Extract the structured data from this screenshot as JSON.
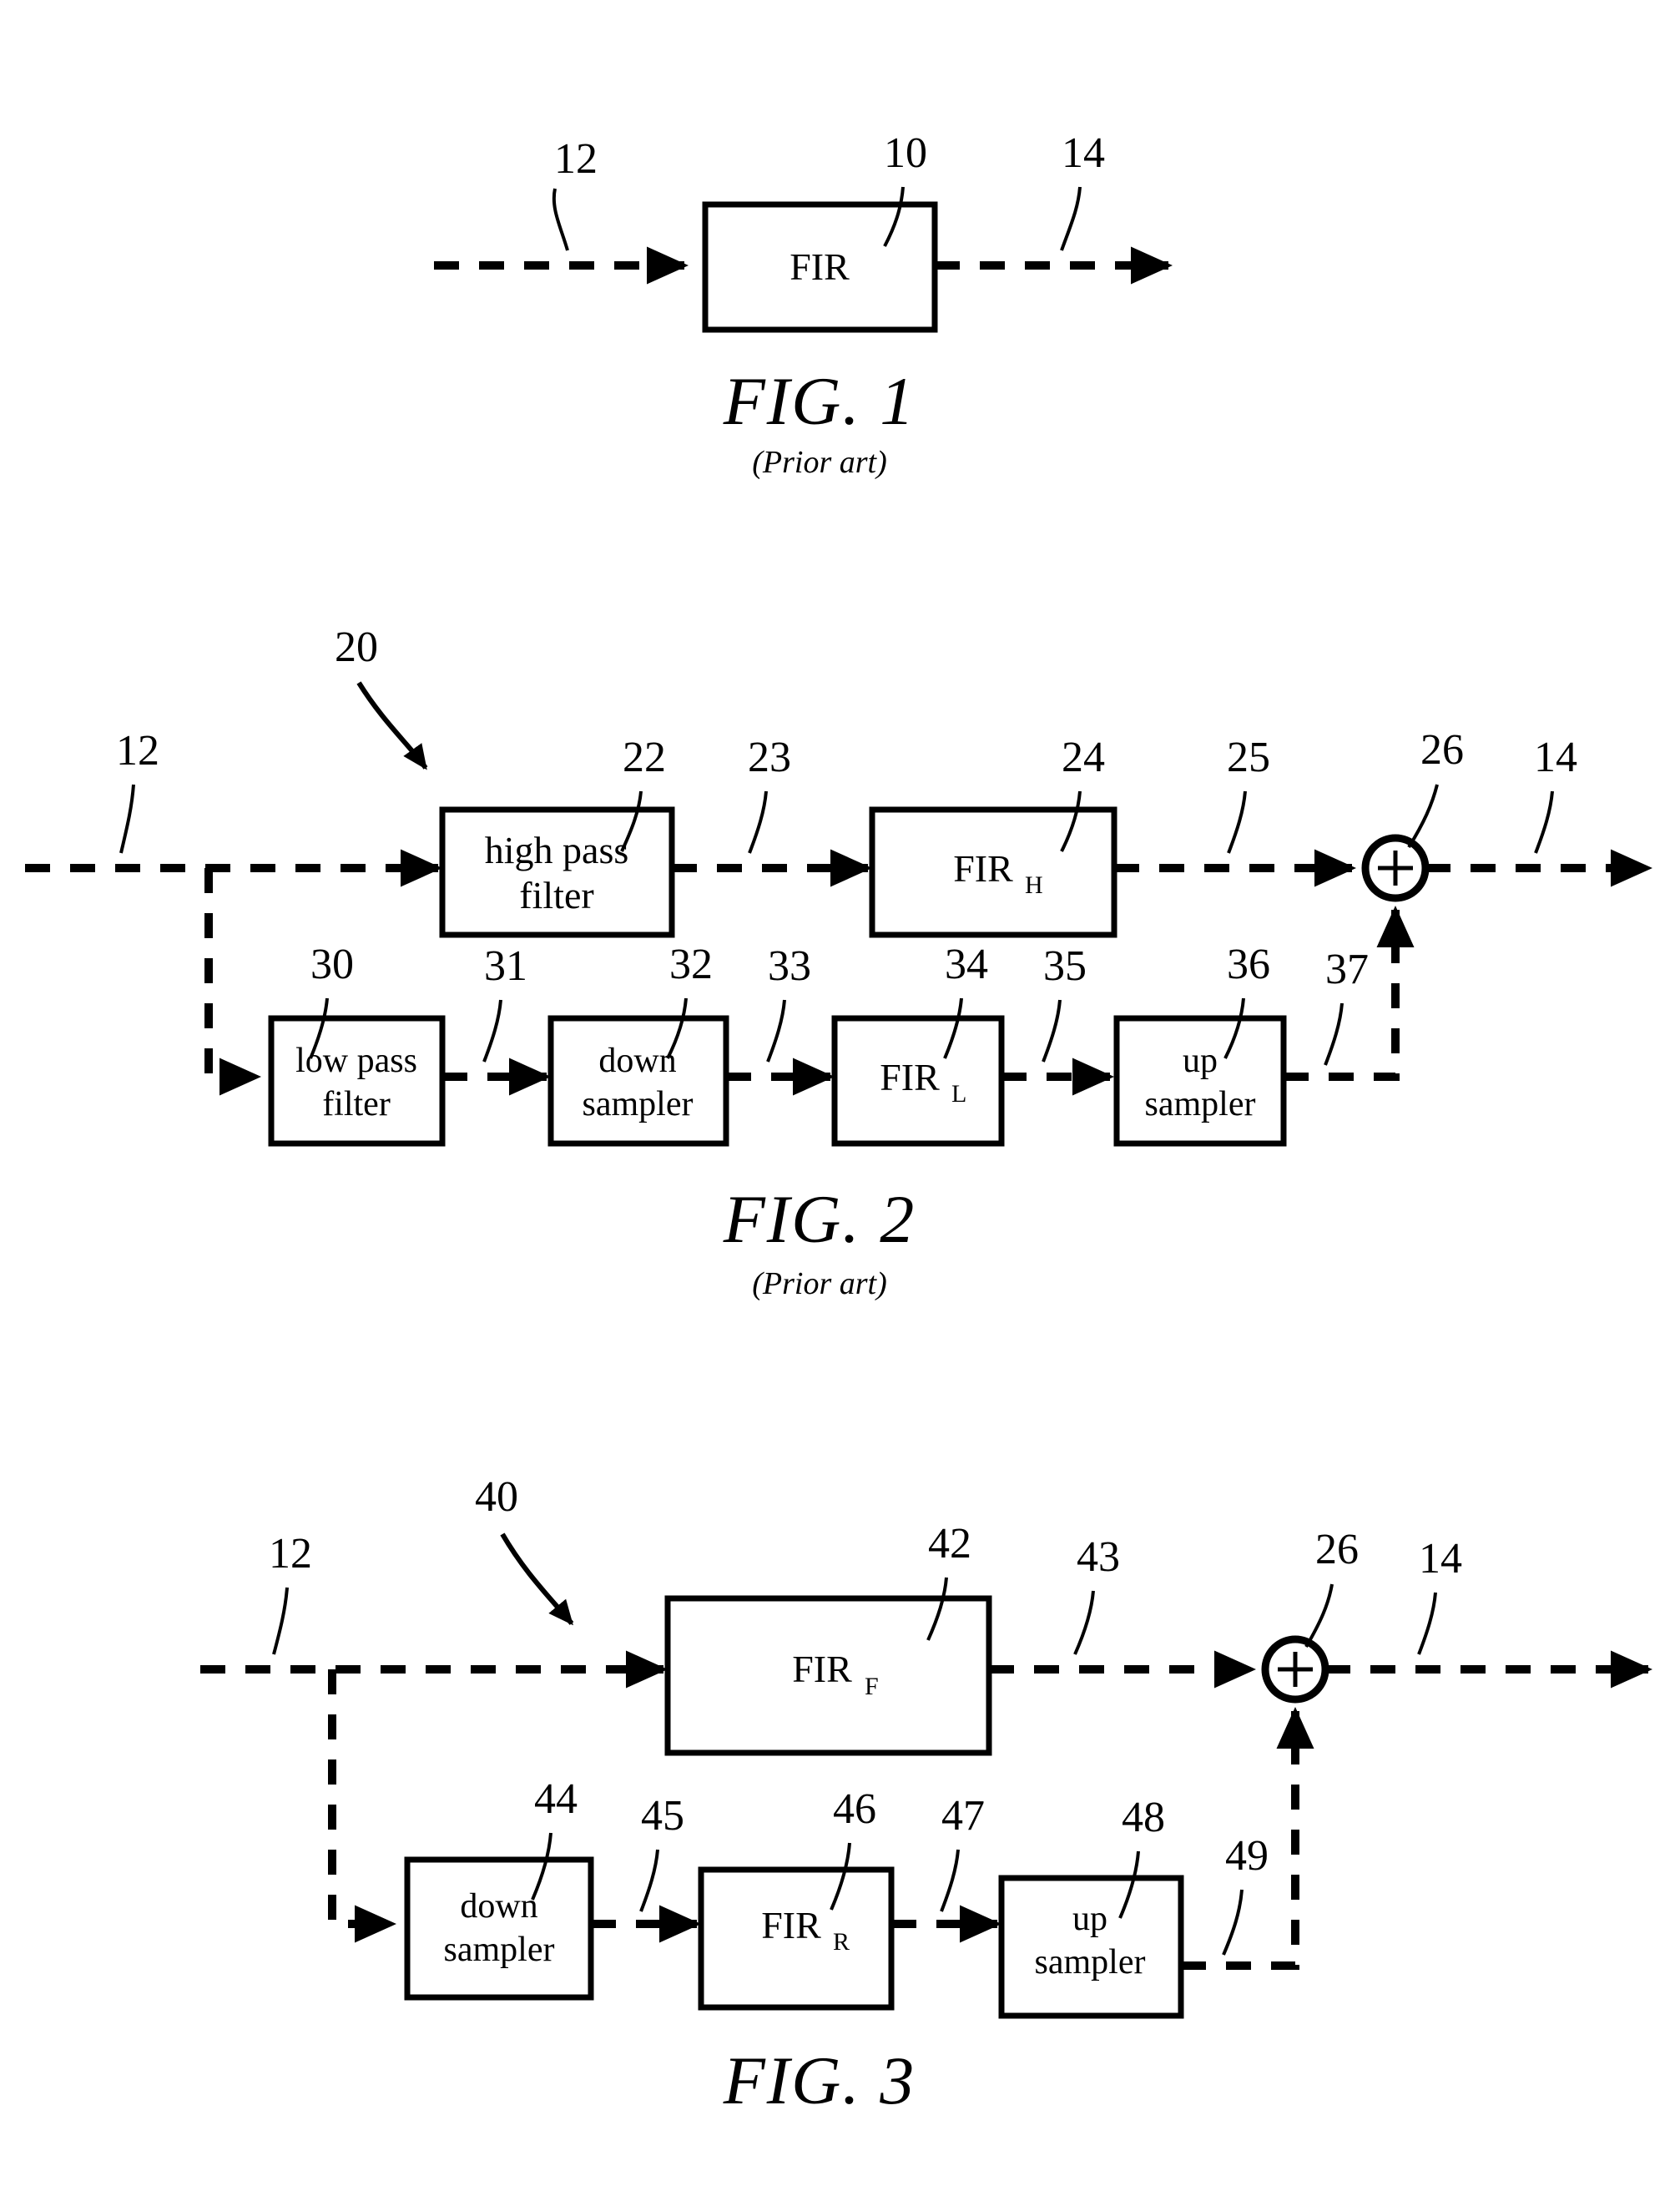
{
  "document": {
    "type": "patent-drawing-sheet",
    "figure_count": 3
  },
  "figures": [
    {
      "id": "fig1",
      "title": "FIG. 1",
      "subtitle": "(Prior art)",
      "blocks": [
        {
          "id": "fir",
          "label": "FIR",
          "subscript": "",
          "ref": "10"
        }
      ],
      "signals": [
        {
          "id": "input",
          "ref": "12"
        },
        {
          "id": "output",
          "ref": "14"
        }
      ]
    },
    {
      "id": "fig2",
      "title": "FIG. 2",
      "subtitle": "(Prior art)",
      "system_ref": "20",
      "blocks": [
        {
          "id": "hpf",
          "label": "high pass filter",
          "line1": "high pass",
          "line2": "filter",
          "ref": "22"
        },
        {
          "id": "firh",
          "label": "FIR",
          "subscript": "H",
          "ref": "24"
        },
        {
          "id": "lpf",
          "label": "low pass filter",
          "line1": "low pass",
          "line2": "filter",
          "ref": "30"
        },
        {
          "id": "down",
          "label": "down sampler",
          "line1": "down",
          "line2": "sampler",
          "ref": "32"
        },
        {
          "id": "firl",
          "label": "FIR",
          "subscript": "L",
          "ref": "34"
        },
        {
          "id": "up",
          "label": "up sampler",
          "line1": "up",
          "line2": "sampler",
          "ref": "36"
        },
        {
          "id": "adder",
          "label": "+",
          "ref": "26"
        }
      ],
      "signals": [
        {
          "id": "input",
          "ref": "12"
        },
        {
          "id": "hpf-out",
          "ref": "23"
        },
        {
          "id": "firh-out",
          "ref": "25"
        },
        {
          "id": "lpf-out",
          "ref": "31"
        },
        {
          "id": "down-out",
          "ref": "33"
        },
        {
          "id": "firl-out",
          "ref": "35"
        },
        {
          "id": "up-out",
          "ref": "37"
        },
        {
          "id": "output",
          "ref": "14"
        }
      ]
    },
    {
      "id": "fig3",
      "title": "FIG. 3",
      "subtitle": "",
      "system_ref": "40",
      "blocks": [
        {
          "id": "firf",
          "label": "FIR",
          "subscript": "F",
          "ref": "42"
        },
        {
          "id": "down",
          "label": "down sampler",
          "line1": "down",
          "line2": "sampler",
          "ref": "44"
        },
        {
          "id": "firr",
          "label": "FIR",
          "subscript": "R",
          "ref": "46"
        },
        {
          "id": "up",
          "label": "up sampler",
          "line1": "up",
          "line2": "sampler",
          "ref": "48"
        },
        {
          "id": "adder",
          "label": "+",
          "ref": "26"
        }
      ],
      "signals": [
        {
          "id": "input",
          "ref": "12"
        },
        {
          "id": "firf-out",
          "ref": "43"
        },
        {
          "id": "down-out",
          "ref": "45"
        },
        {
          "id": "firr-out",
          "ref": "47"
        },
        {
          "id": "up-out",
          "ref": "49"
        },
        {
          "id": "output",
          "ref": "14"
        }
      ]
    }
  ],
  "style": {
    "ink": "#000000",
    "paper": "#ffffff"
  }
}
